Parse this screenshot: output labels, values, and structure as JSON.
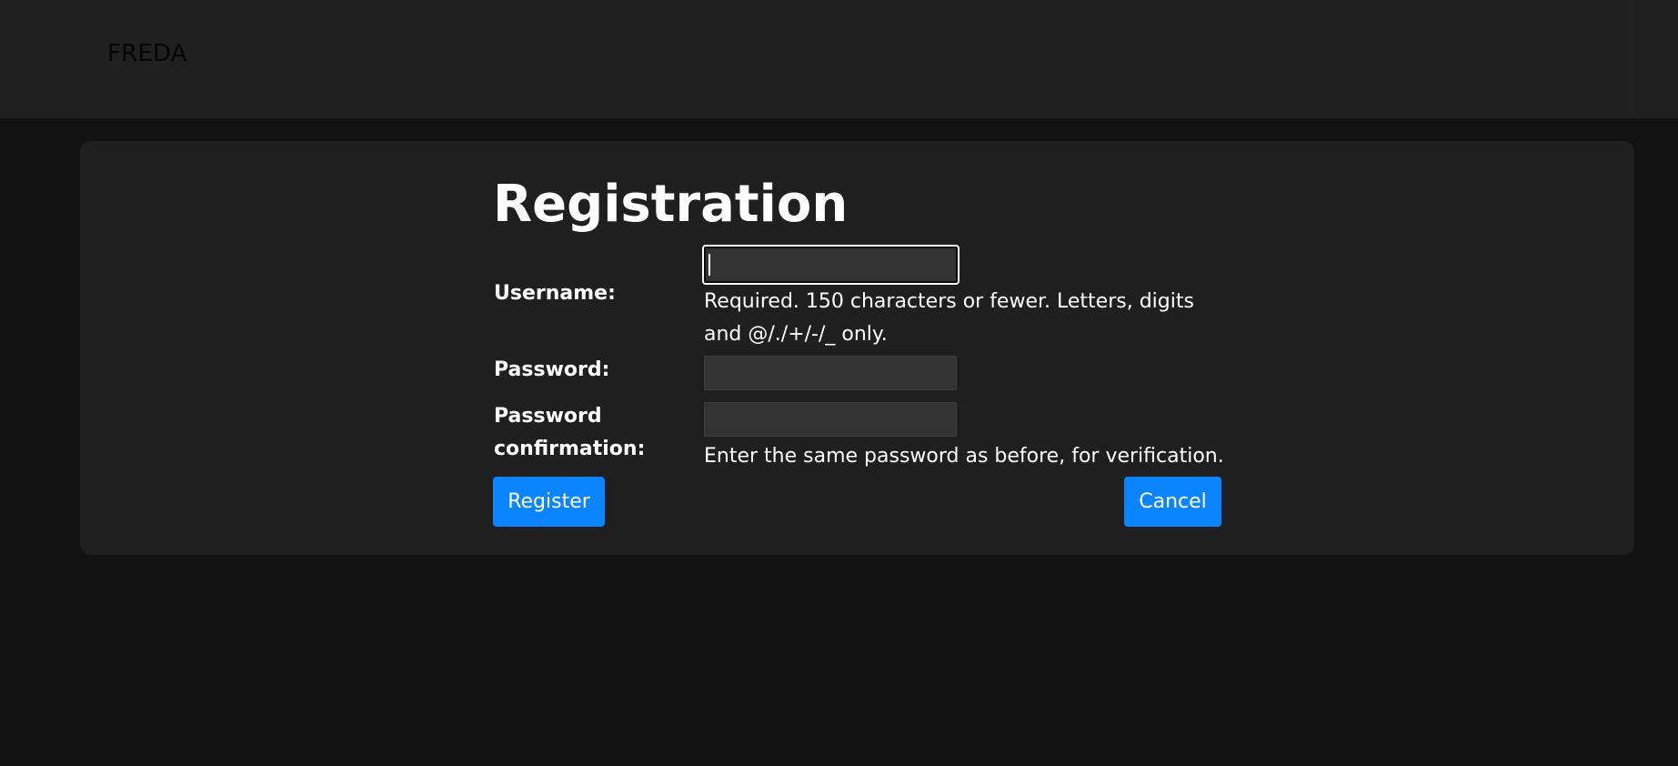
{
  "navbar": {
    "brand": "FREDA"
  },
  "form": {
    "title": "Registration",
    "username": {
      "label": "Username:",
      "value": "",
      "help": "Required. 150 characters or fewer. Letters, digits and @/./+/-/_ only."
    },
    "password": {
      "label": "Password:",
      "value": ""
    },
    "password_confirmation": {
      "label": "Password confirmation:",
      "value": "",
      "help": "Enter the same password as before, for verification."
    },
    "register_label": "Register",
    "cancel_label": "Cancel"
  },
  "colors": {
    "background": "#121212",
    "card": "#1f1f1f",
    "input": "#333333",
    "primary_button": "#0a84ff"
  }
}
